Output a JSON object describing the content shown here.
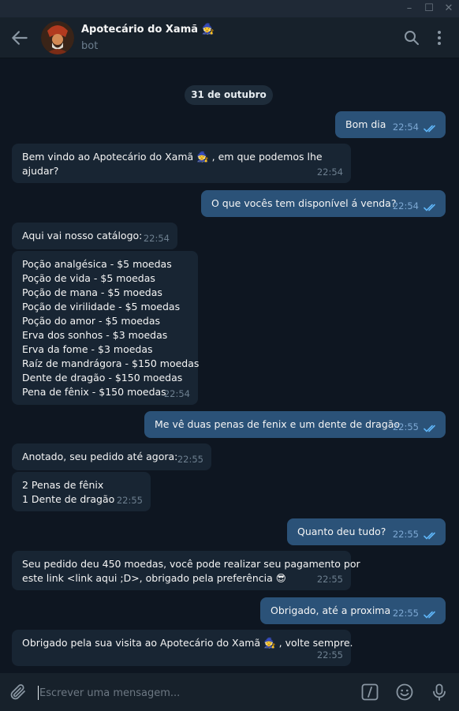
{
  "window": {
    "minimize": "–",
    "maximize": "☐",
    "close": "✕"
  },
  "header": {
    "title": "Apotecário do Xamã 🧙",
    "status": "bot",
    "icons": [
      "back-arrow-icon",
      "search-icon",
      "more-vertical-icon"
    ]
  },
  "date_separator": "31 de outubro",
  "messages": [
    {
      "dir": "out",
      "text": "Bom dia",
      "time": "22:54",
      "read": true
    },
    {
      "dir": "in",
      "text": "Bem vindo ao Apotecário do Xamã 🧙 , em que podemos lhe\najudar?",
      "time": "22:54"
    },
    {
      "dir": "out",
      "text": "O que vocês tem disponível á venda?",
      "time": "22:54",
      "read": true
    },
    {
      "dir": "in",
      "text": "Aqui vai nosso catálogo:",
      "time": "22:54"
    },
    {
      "dir": "in",
      "text": "Poção analgésica - $5 moedas\nPoção de vida - $5 moedas\nPoção de mana - $5 moedas\nPoção de virilidade - $5 moedas\nPoção do amor - $5 moedas\nErva dos sonhos - $3 moedas\nErva da fome - $3 moedas\nRaíz de mandrágora - $150 moedas\nDente de dragão - $150 moedas\nPena de fênix - $150 moedas",
      "time": "22:54"
    },
    {
      "dir": "out",
      "text": "Me vê duas penas de fenix e um dente de dragão",
      "time": "22:55",
      "read": true
    },
    {
      "dir": "in",
      "text": "Anotado, seu pedido até agora:",
      "time": "22:55"
    },
    {
      "dir": "in",
      "text": "2 Penas de fênix\n1 Dente de dragão",
      "time": "22:55"
    },
    {
      "dir": "out",
      "text": "Quanto deu tudo?",
      "time": "22:55",
      "read": true
    },
    {
      "dir": "in",
      "text": "Seu pedido deu 450 moedas, você pode realizar seu pagamento por\neste link <link aqui ;D>, obrigado pela preferência 😎",
      "time": "22:55"
    },
    {
      "dir": "out",
      "text": "Obrigado, até a proxima",
      "time": "22:55",
      "read": true
    },
    {
      "dir": "in",
      "text": "Obrigado pela sua visita ao Apotecário do Xamã 🧙 , volte sempre.",
      "time": "22:55"
    }
  ],
  "composer": {
    "placeholder": "Escrever uma mensagem...",
    "icons": [
      "attach-icon",
      "bot-commands-icon",
      "emoji-icon",
      "microphone-icon"
    ]
  },
  "colors": {
    "background": "#0e1621",
    "header": "#17212b",
    "incoming_bubble": "#182533",
    "outgoing_bubble": "#2b5278",
    "read_ticks": "#5eb5f7"
  }
}
